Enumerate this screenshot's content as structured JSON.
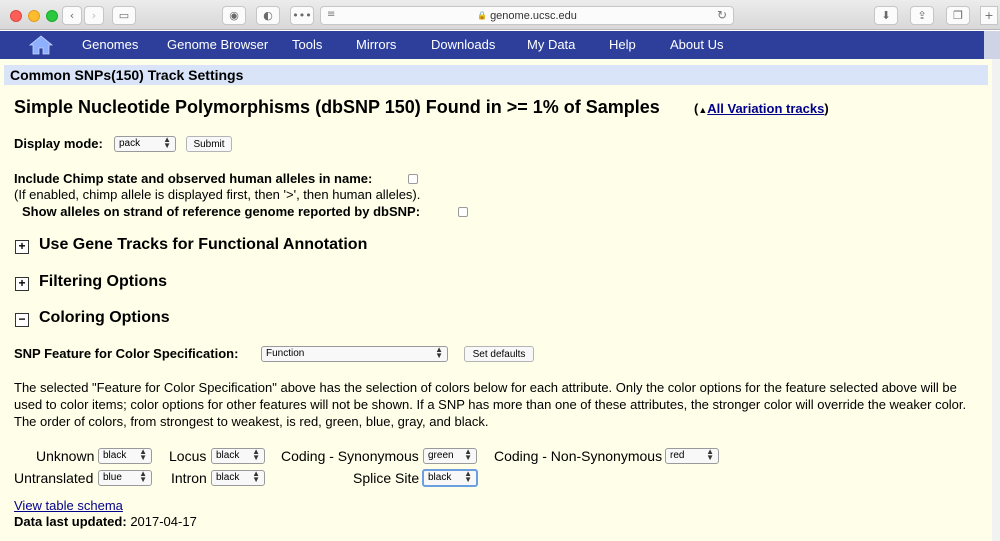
{
  "browser": {
    "url": "genome.ucsc.edu"
  },
  "nav": {
    "items": [
      "Genomes",
      "Genome Browser",
      "Tools",
      "Mirrors",
      "Downloads",
      "My Data",
      "Help",
      "About Us"
    ]
  },
  "track_header": "Common SNPs(150) Track Settings",
  "title": "Simple Nucleotide Polymorphisms (dbSNP 150) Found in >= 1% of Samples",
  "variation_link": {
    "open": "(",
    "arrow": "▲",
    "label": "All Variation tracks",
    "close": ")"
  },
  "display_mode": {
    "label": "Display mode:",
    "value": "pack",
    "submit": "Submit"
  },
  "chimp": {
    "label": "Include Chimp state and observed human alleles in name:",
    "note": "(If enabled, chimp allele is displayed first, then '>', then human alleles)."
  },
  "strand_label": "Show alleles on strand of reference genome reported by dbSNP:",
  "sections": [
    {
      "toggle": "+",
      "title": "Use Gene Tracks for Functional Annotation"
    },
    {
      "toggle": "+",
      "title": "Filtering Options"
    },
    {
      "toggle": "−",
      "title": "Coloring Options"
    }
  ],
  "color_spec": {
    "label": "SNP Feature for Color Specification:",
    "value": "Function",
    "defaults": "Set defaults"
  },
  "description": "The selected \"Feature for Color Specification\" above has the selection of colors below for each attribute. Only the color options for the feature selected above will be used to color items; color options for other features will not be shown. If a SNP has more than one of these attributes, the stronger color will override the weaker color. The order of colors, from strongest to weakest, is red, green, blue, gray, and black.",
  "attributes": [
    {
      "label": "Unknown",
      "value": "black"
    },
    {
      "label": "Locus",
      "value": "black"
    },
    {
      "label": "Coding - Synonymous",
      "value": "green"
    },
    {
      "label": "Coding - Non-Synonymous",
      "value": "red"
    },
    {
      "label": "Untranslated",
      "value": "blue"
    },
    {
      "label": "Intron",
      "value": "black"
    },
    {
      "label": "Splice Site",
      "value": "black"
    }
  ],
  "schema_link": "View table schema",
  "updated": {
    "label": "Data last updated:",
    "value": "2017-04-17"
  },
  "colors": {
    "nav_bg": "#2d3f9a",
    "page_bg": "#fffee8",
    "header_bg": "#d9e4f8",
    "link": "#00008b"
  }
}
